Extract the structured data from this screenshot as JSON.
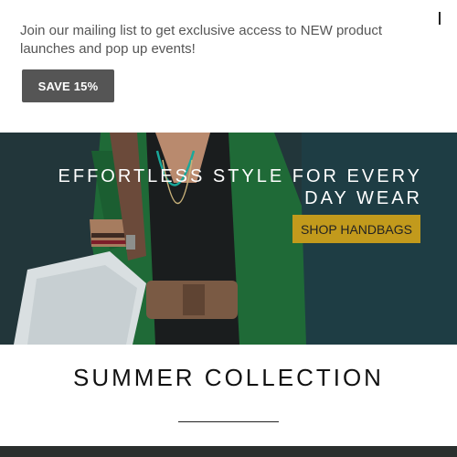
{
  "promo": {
    "message": "Join our mailing list to get exclusive access to NEW product launches and pop up events!",
    "save_label": "SAVE 15%",
    "close_icon": "close-icon"
  },
  "hero": {
    "headline": "EFFORTLESS STYLE FOR EVERY DAY WEAR",
    "cta_label": "SHOP HANDBAGS",
    "cta_color": "#c29a1c"
  },
  "collection": {
    "title": "SUMMER COLLECTION"
  }
}
